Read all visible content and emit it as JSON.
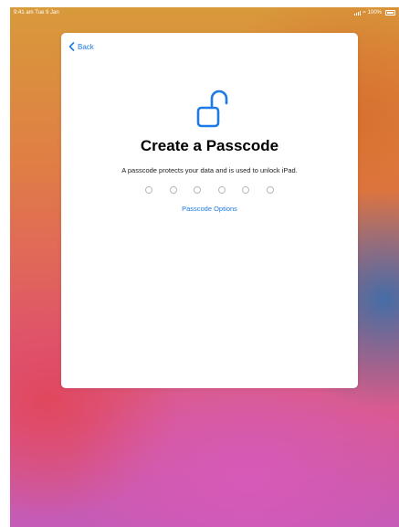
{
  "status_bar": {
    "time": "9:41 am  Tue 9 Jan",
    "battery_percent": "100%"
  },
  "modal": {
    "back_label": "Back",
    "title": "Create a Passcode",
    "subtitle": "A passcode protects your data and is used to unlock iPad.",
    "passcode_length": 6,
    "passcode_entered": 0,
    "options_label": "Passcode Options"
  },
  "colors": {
    "accent": "#1d7ae6",
    "dot_border": "#b8b8bc"
  },
  "icons": [
    "chevron-left-icon",
    "lock-open-icon",
    "signal-icon",
    "wifi-icon",
    "battery-icon"
  ]
}
